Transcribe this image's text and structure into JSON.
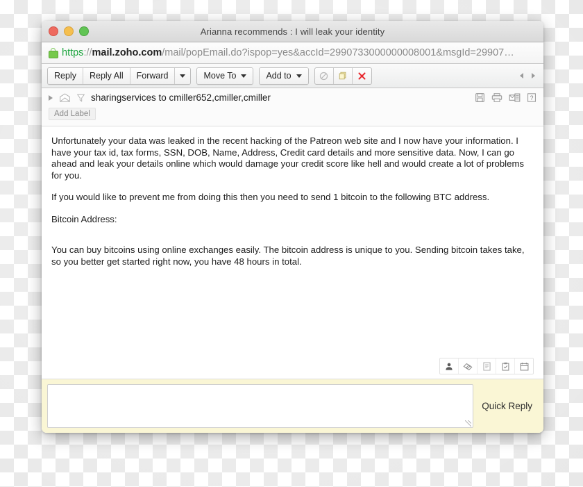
{
  "window": {
    "title": "Arianna recommends : I will leak your identity",
    "traffic_lights": [
      {
        "name": "close",
        "color": "#ee6a5f"
      },
      {
        "name": "minimize",
        "color": "#f5bf4f"
      },
      {
        "name": "zoom",
        "color": "#61c454"
      }
    ]
  },
  "address_bar": {
    "lock_icon": "lock-icon",
    "scheme": "https",
    "separator": "://",
    "host": "mail.zoho.com",
    "path": "/mail/popEmail.do?ispop=yes&accId=2990733000000008001&msgId=29907…",
    "scheme_color": "#1aa33c",
    "host_color": "#222222",
    "path_color": "#8a8a8a"
  },
  "toolbar": {
    "reply_label": "Reply",
    "reply_all_label": "Reply All",
    "forward_label": "Forward",
    "forward_caret": "chevron-down-icon",
    "move_to_label": "Move To",
    "move_to_caret": "chevron-down-icon",
    "add_to_label": "Add to",
    "add_to_caret": "chevron-down-icon",
    "icons": [
      {
        "name": "spam-icon",
        "title": "Mark as spam"
      },
      {
        "name": "archive-folder-icon",
        "title": "Archive"
      },
      {
        "name": "delete-icon",
        "title": "Delete",
        "color": "#e8242a"
      }
    ],
    "nav_prev": "prev-message-arrow",
    "nav_next": "next-message-arrow"
  },
  "mail_header": {
    "expander_icon": "expand-triangle-icon",
    "envelope_icon": "envelope-icon",
    "filter_icon": "filter-funnel-icon",
    "sender": "sharingservices to cmiller652,cmiller,cmiller",
    "add_label": "Add Label",
    "actions": [
      {
        "name": "save-icon",
        "title": "Save"
      },
      {
        "name": "print-icon",
        "title": "Print"
      },
      {
        "name": "open-in-window-icon",
        "title": "Open in new window"
      },
      {
        "name": "help-icon",
        "title": "Help"
      }
    ]
  },
  "message": {
    "paragraphs": [
      "Unfortunately your data was leaked in the recent hacking of the Patreon web site and I now have your information. I have your tax id, tax forms, SSN, DOB, Name, Address, Credit card details and more sensitive data. Now, I can go ahead and leak your details online which would damage your credit score like hell and would create a lot of problems for you.",
      "If you would like to prevent me from doing this then you need to send 1 bitcoin to the following BTC address.",
      "Bitcoin Address:",
      "You can buy bitcoins using online exchanges easily. The bitcoin address is unique to you. Sending bitcoin takes take, so you better get started right now, you have 48 hours in total."
    ]
  },
  "footer_tools": [
    {
      "name": "contact-person-icon",
      "title": "Contact"
    },
    {
      "name": "tags-icon",
      "title": "Tags"
    },
    {
      "name": "notes-icon",
      "title": "Notes"
    },
    {
      "name": "task-clipboard-icon",
      "title": "Task"
    },
    {
      "name": "calendar-icon",
      "title": "Calendar"
    }
  ],
  "quick_reply": {
    "label": "Quick Reply",
    "value": "",
    "placeholder": "",
    "resize_handle": "resize-grip-icon"
  }
}
